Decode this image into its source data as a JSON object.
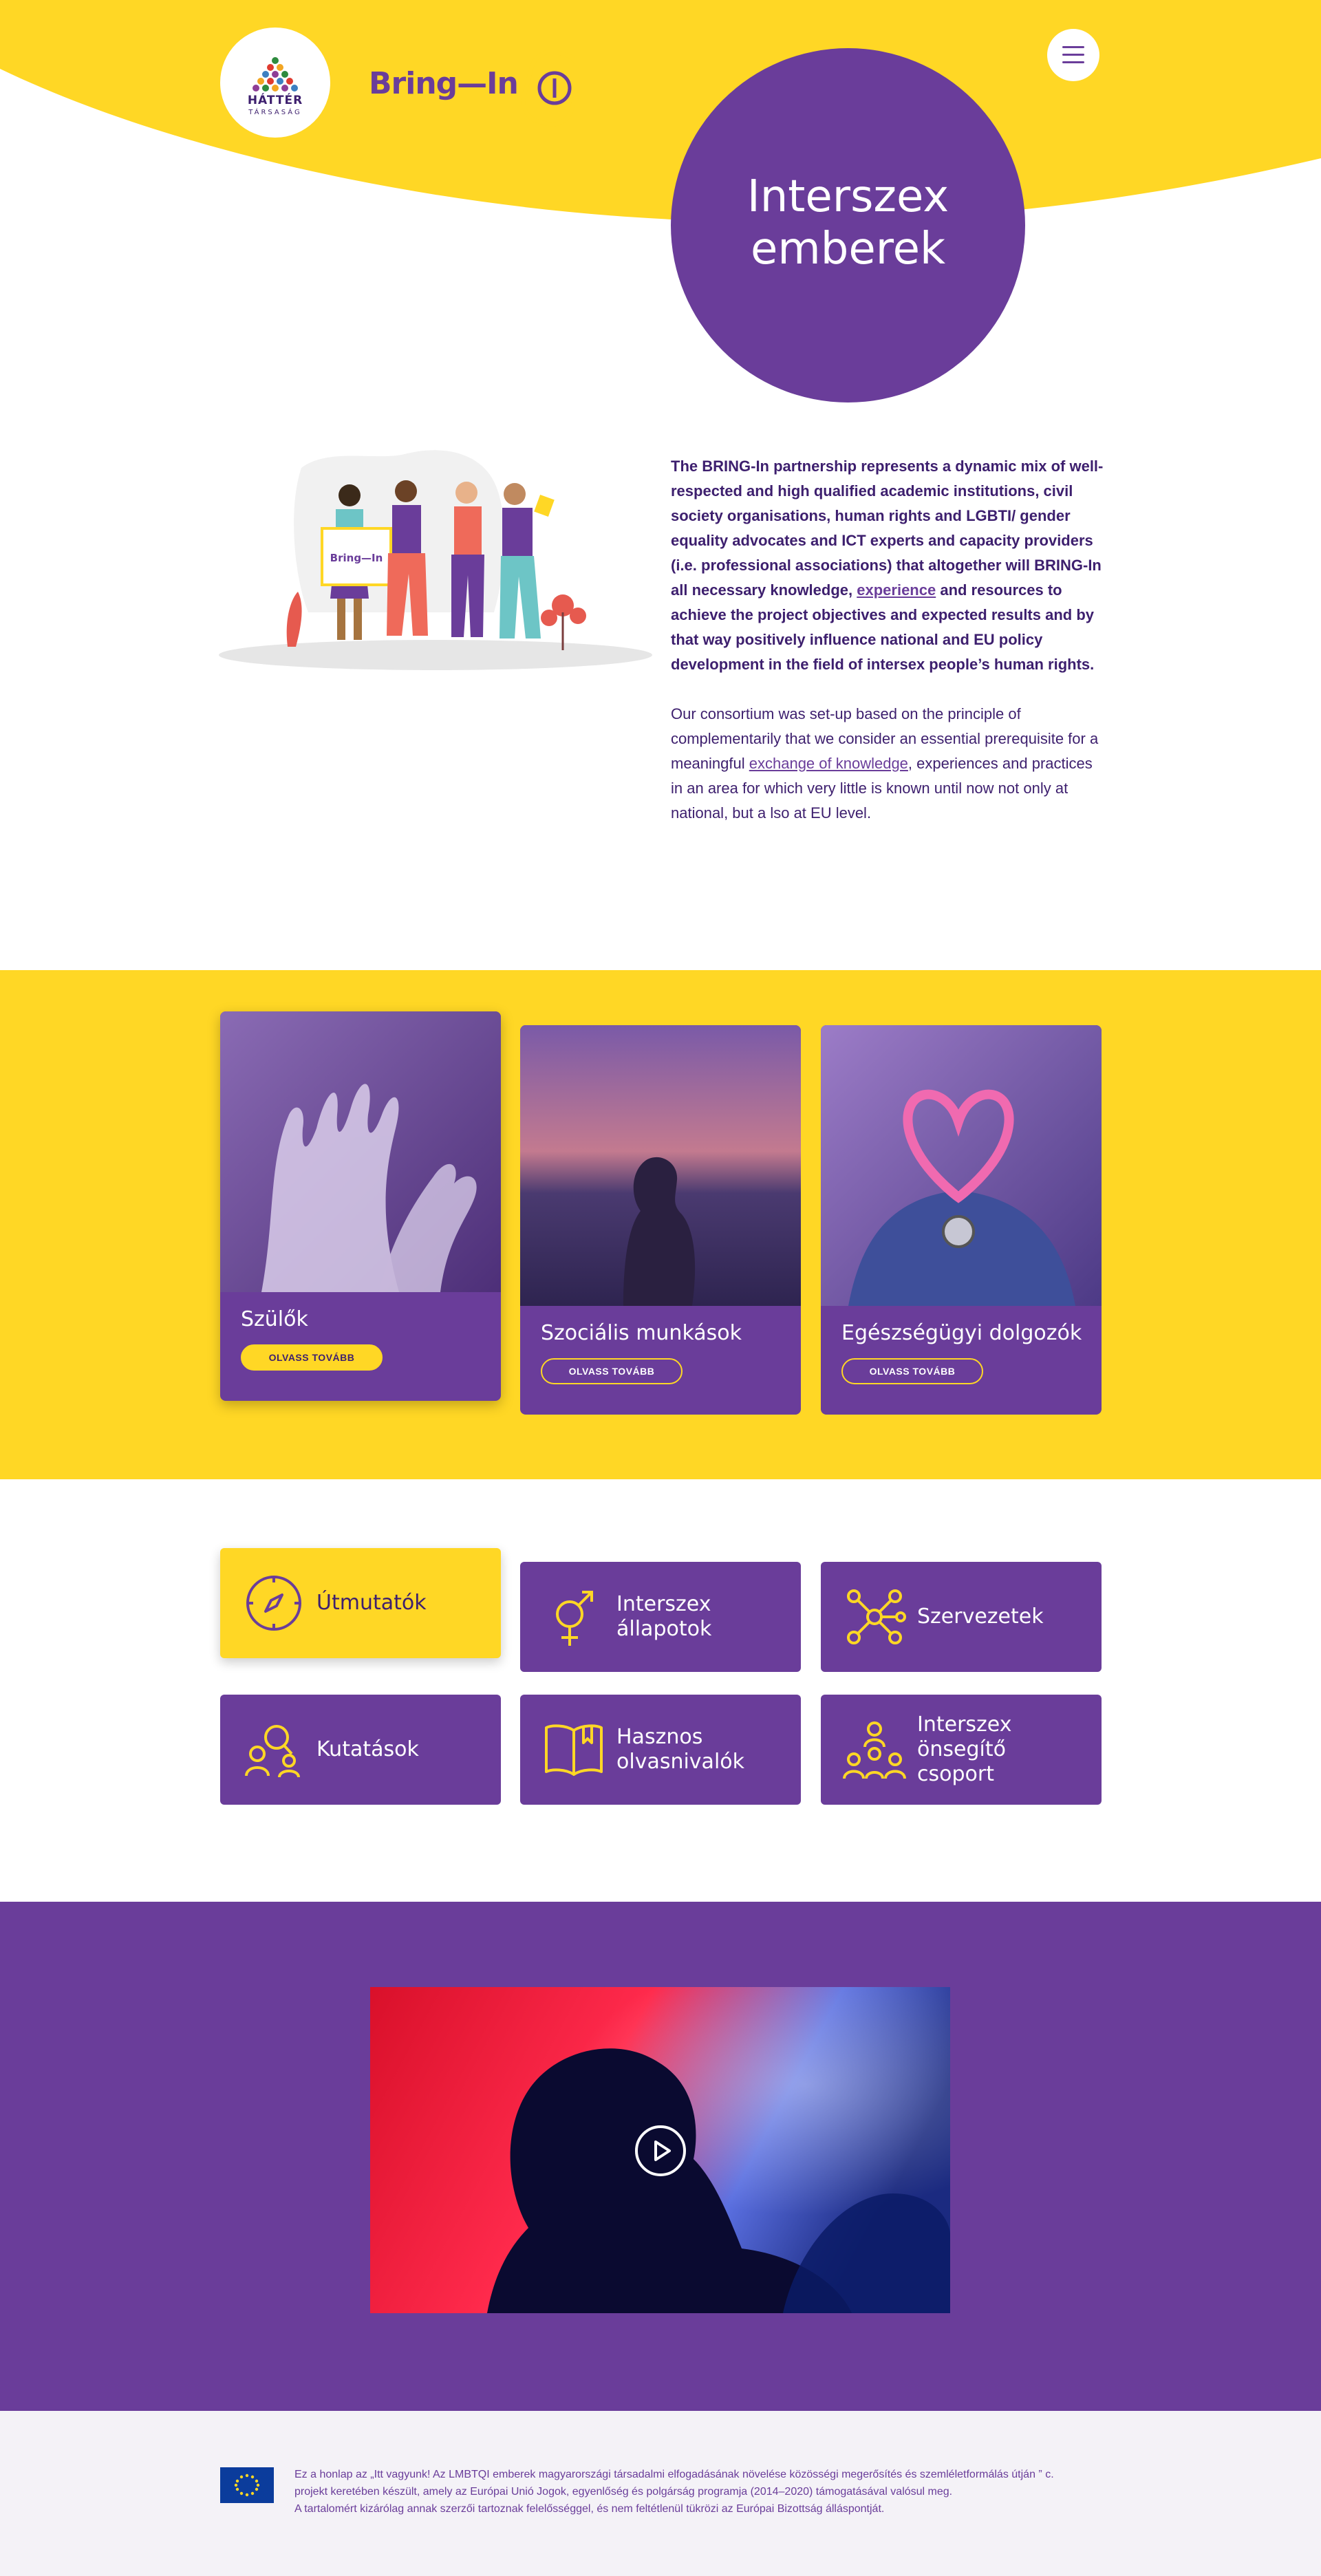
{
  "colors": {
    "purple": "#6a3d9a",
    "yellow": "#ffd725",
    "dark_purple": "#3d1f6e",
    "footer_bg": "#f4f2f7"
  },
  "header": {
    "hatter_logo_text": "HÁTTÉR",
    "hatter_logo_sub": "TÁRSASÁG",
    "bringin_logo_text": "Bring—In",
    "menu_icon": "hamburger-icon",
    "page_title": "Interszex emberek"
  },
  "intro": {
    "p1_start": "The BRING-In partnership represents a dynamic mix of well-respected and high qualified academic institutions, civil society organisations, human rights and LGBTI/ gender equality advocates and ICT experts and capacity providers (i.e. professional associations) that altogether will BRING-In all necessary knowledge, ",
    "p1_link": "experience",
    "p1_end": " and resources to achieve the project objectives and expected results and by that way positively influence national and EU policy development in the field of intersex people’s human rights.",
    "p2_start": "Our consortium was set-up based on the principle of complementarily that we consider an essential prerequisite for a meaningful ",
    "p2_link": "exchange of knowledge",
    "p2_end": ", experiences and practices in an area for which very little is known until now not only at national, but a lso at EU level.",
    "illustration_sign": "Bring—In"
  },
  "cards": [
    {
      "title": "Szülők",
      "button": "OLVASS TOVÁBB"
    },
    {
      "title": "Szociális munkások",
      "button": "OLVASS TOVÁBB"
    },
    {
      "title": "Egészségügyi dolgozók",
      "button": "OLVASS TOVÁBB"
    }
  ],
  "tiles": [
    {
      "label": "Útmutatók",
      "icon": "compass-icon"
    },
    {
      "label": "Interszex állapotok",
      "icon": "intersex-symbol-icon"
    },
    {
      "label": "Szervezetek",
      "icon": "network-icon"
    },
    {
      "label": "Kutatások",
      "icon": "people-search-icon"
    },
    {
      "label": "Hasznos olvasnivalók",
      "icon": "open-book-icon"
    },
    {
      "label": "Interszex önsegítő csoport",
      "icon": "group-icon"
    }
  ],
  "video": {
    "play_icon": "play-icon"
  },
  "footer": {
    "line1": "Ez a honlap az „Itt vagyunk! Az LMBTQI emberek magyarországi társadalmi elfogadásának növelése közösségi megerősítés és szemléletformálás útján ” c.",
    "line2": "projekt keretében készült, amely az Európai Unió Jogok, egyenlőség és polgárság programja (2014–2020) támogatásával valósul meg.",
    "line3": "A tartalomért kizárólag annak szerzői tartoznak felelősséggel, és nem feltétlenül tükrözi az Európai Bizottság álláspontját.",
    "eu_flag": "eu-flag-icon"
  }
}
